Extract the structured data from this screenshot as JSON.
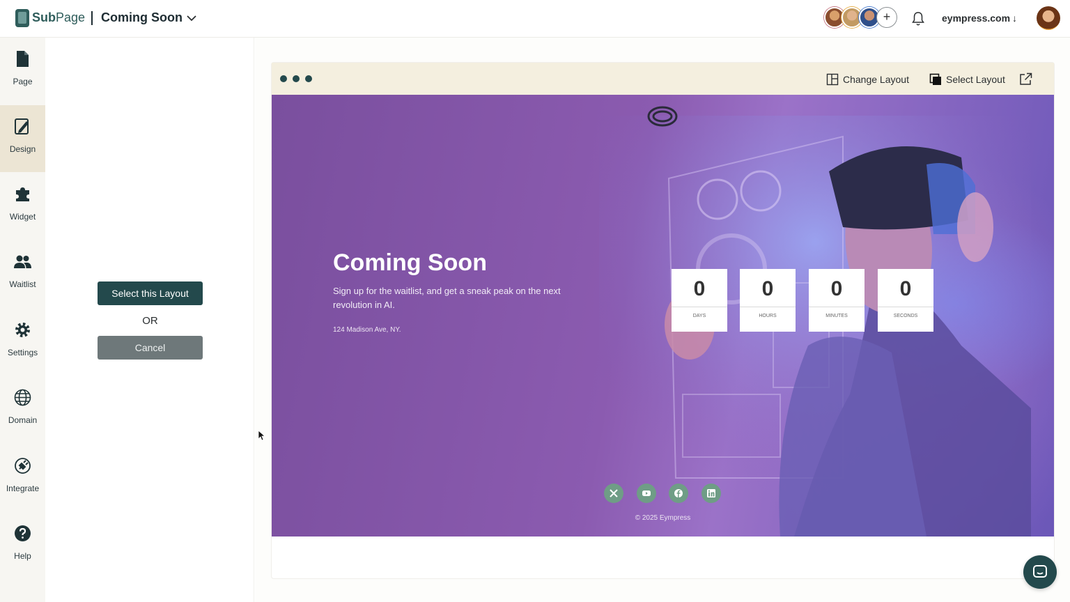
{
  "topbar": {
    "app_name_bold": "Sub",
    "app_name_rest": "Page",
    "page_title": "Coming Soon",
    "domain": "eympress.com",
    "domain_arrow": "↓",
    "add_symbol": "+"
  },
  "sidebar": {
    "items": [
      {
        "label": "Page",
        "icon": "page-icon"
      },
      {
        "label": "Design",
        "icon": "design-icon"
      },
      {
        "label": "Widget",
        "icon": "puzzle-icon"
      },
      {
        "label": "Waitlist",
        "icon": "users-icon"
      },
      {
        "label": "Settings",
        "icon": "gear-icon"
      },
      {
        "label": "Domain",
        "icon": "globe-icon"
      },
      {
        "label": "Integrate",
        "icon": "plug-icon"
      },
      {
        "label": "Help",
        "icon": "help-icon"
      }
    ],
    "active": "Design"
  },
  "layout_panel": {
    "select_label": "Select this Layout",
    "or_label": "OR",
    "cancel_label": "Cancel"
  },
  "preview_toolbar": {
    "change_layout": "Change Layout",
    "select_layout": "Select Layout"
  },
  "hero": {
    "title": "Coming Soon",
    "subtitle": "Sign up for the waitlist, and get a sneak peak on the next revolution in AI.",
    "address": "124 Madison Ave, NY.",
    "countdown": [
      {
        "value": "0",
        "label": "DAYS"
      },
      {
        "value": "0",
        "label": "HOURS"
      },
      {
        "value": "0",
        "label": "MINUTES"
      },
      {
        "value": "0",
        "label": "SECONDS"
      }
    ],
    "socials": [
      "x-icon",
      "youtube-icon",
      "facebook-icon",
      "linkedin-icon"
    ],
    "copyright": "© 2025 Eympress"
  },
  "colors": {
    "accent": "#23494c",
    "sidebar_bg": "#f7f6f2",
    "active_nav": "#ece5d4",
    "browser_bar": "#f4efdf",
    "social": "#6f9d86"
  }
}
